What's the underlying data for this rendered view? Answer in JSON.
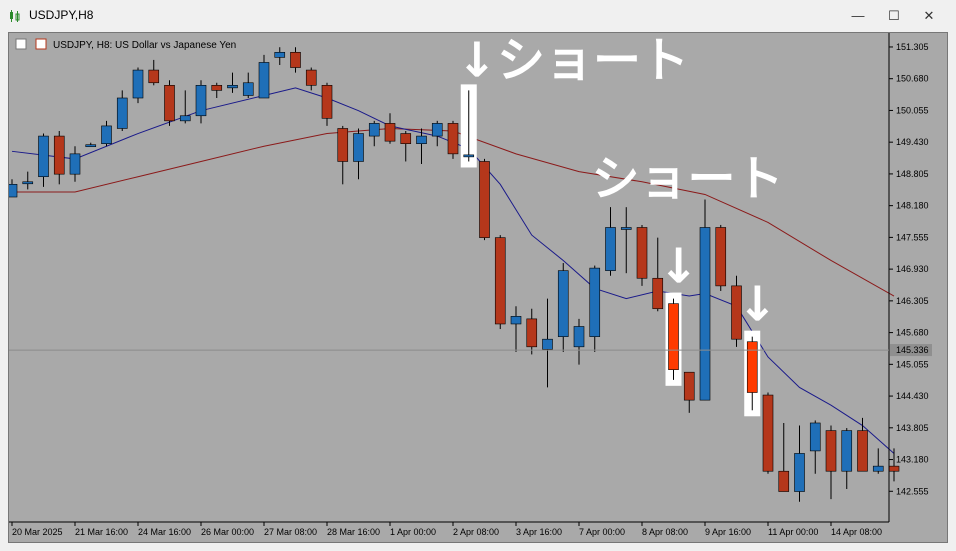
{
  "window": {
    "title": "USDJPY,H8",
    "minimize": "—",
    "maximize": "☐",
    "close": "✕"
  },
  "chart_data": {
    "type": "candlestick",
    "symbol_label": "USDJPY, H8:  US Dollar vs Japanese Yen",
    "y_ticks": [
      "151.305",
      "150.680",
      "150.055",
      "149.430",
      "148.805",
      "148.180",
      "147.555",
      "146.930",
      "146.305",
      "145.680",
      "145.055",
      "144.430",
      "143.805",
      "143.180",
      "142.555"
    ],
    "ylim": [
      141.95,
      151.58
    ],
    "current_price": "145.336",
    "x_ticks": [
      "20 Mar 2025",
      "21 Mar 16:00",
      "24 Mar 16:00",
      "26 Mar 00:00",
      "27 Mar 08:00",
      "28 Mar 16:00",
      "1 Apr 00:00",
      "2 Apr 08:00",
      "3 Apr 16:00",
      "7 Apr 00:00",
      "8 Apr 08:00",
      "9 Apr 16:00",
      "11 Apr 00:00",
      "14 Apr 08:00"
    ],
    "colors": {
      "bull": "#1f6fb8",
      "bear": "#b5371b",
      "highlight_bear": "#ff3b00",
      "ma_fast": "#1a1a8a",
      "ma_slow": "#8b1a1a",
      "background": "#a9a9a9"
    },
    "candles": [
      {
        "o": 148.35,
        "h": 148.7,
        "l": 148.35,
        "c": 148.6
      },
      {
        "o": 148.65,
        "h": 148.85,
        "l": 148.5,
        "c": 148.65
      },
      {
        "o": 148.75,
        "h": 149.6,
        "l": 148.55,
        "c": 149.55
      },
      {
        "o": 149.55,
        "h": 149.65,
        "l": 148.6,
        "c": 148.8
      },
      {
        "o": 148.8,
        "h": 149.35,
        "l": 148.65,
        "c": 149.2
      },
      {
        "o": 149.38,
        "h": 149.42,
        "l": 149.34,
        "c": 149.38
      },
      {
        "o": 149.4,
        "h": 149.85,
        "l": 149.35,
        "c": 149.75
      },
      {
        "o": 149.7,
        "h": 150.45,
        "l": 149.65,
        "c": 150.3
      },
      {
        "o": 150.3,
        "h": 150.9,
        "l": 150.2,
        "c": 150.85
      },
      {
        "o": 150.85,
        "h": 151.05,
        "l": 150.55,
        "c": 150.6
      },
      {
        "o": 150.55,
        "h": 150.65,
        "l": 149.75,
        "c": 149.85
      },
      {
        "o": 149.85,
        "h": 150.45,
        "l": 149.8,
        "c": 149.95
      },
      {
        "o": 149.95,
        "h": 150.65,
        "l": 149.8,
        "c": 150.55
      },
      {
        "o": 150.55,
        "h": 150.6,
        "l": 150.3,
        "c": 150.45
      },
      {
        "o": 150.5,
        "h": 150.8,
        "l": 150.4,
        "c": 150.55
      },
      {
        "o": 150.35,
        "h": 150.8,
        "l": 150.3,
        "c": 150.6
      },
      {
        "o": 150.3,
        "h": 151.15,
        "l": 150.3,
        "c": 151.0
      },
      {
        "o": 151.1,
        "h": 151.3,
        "l": 150.95,
        "c": 151.2
      },
      {
        "o": 151.2,
        "h": 151.3,
        "l": 150.8,
        "c": 150.9
      },
      {
        "o": 150.85,
        "h": 150.9,
        "l": 150.45,
        "c": 150.55
      },
      {
        "o": 150.55,
        "h": 150.6,
        "l": 149.75,
        "c": 149.9
      },
      {
        "o": 149.7,
        "h": 149.75,
        "l": 148.6,
        "c": 149.05
      },
      {
        "o": 149.05,
        "h": 149.7,
        "l": 148.7,
        "c": 149.6
      },
      {
        "o": 149.55,
        "h": 149.85,
        "l": 149.35,
        "c": 149.8
      },
      {
        "o": 149.8,
        "h": 150.0,
        "l": 149.4,
        "c": 149.45
      },
      {
        "o": 149.6,
        "h": 149.65,
        "l": 149.05,
        "c": 149.4
      },
      {
        "o": 149.4,
        "h": 149.7,
        "l": 149.0,
        "c": 149.55
      },
      {
        "o": 149.55,
        "h": 149.85,
        "l": 149.35,
        "c": 149.8
      },
      {
        "o": 149.8,
        "h": 149.85,
        "l": 149.1,
        "c": 149.2
      },
      {
        "o": 149.18,
        "h": 150.45,
        "l": 149.05,
        "c": 149.18
      },
      {
        "o": 149.05,
        "h": 149.1,
        "l": 147.5,
        "c": 147.55
      },
      {
        "o": 147.55,
        "h": 147.6,
        "l": 145.75,
        "c": 145.85
      },
      {
        "o": 145.85,
        "h": 146.2,
        "l": 145.3,
        "c": 146.0
      },
      {
        "o": 145.95,
        "h": 146.15,
        "l": 145.25,
        "c": 145.4
      },
      {
        "o": 145.35,
        "h": 146.35,
        "l": 144.6,
        "c": 145.55
      },
      {
        "o": 145.6,
        "h": 147.05,
        "l": 145.3,
        "c": 146.9
      },
      {
        "o": 145.4,
        "h": 145.95,
        "l": 145.05,
        "c": 145.8
      },
      {
        "o": 145.6,
        "h": 147.0,
        "l": 145.3,
        "c": 146.95
      },
      {
        "o": 146.9,
        "h": 148.15,
        "l": 146.8,
        "c": 147.75
      },
      {
        "o": 147.75,
        "h": 148.15,
        "l": 146.85,
        "c": 147.75
      },
      {
        "o": 147.75,
        "h": 147.8,
        "l": 146.6,
        "c": 146.75
      },
      {
        "o": 146.75,
        "h": 147.55,
        "l": 146.1,
        "c": 146.15
      },
      {
        "o": 146.25,
        "h": 146.35,
        "l": 144.75,
        "c": 144.95
      },
      {
        "o": 144.9,
        "h": 144.9,
        "l": 144.1,
        "c": 144.35
      },
      {
        "o": 144.35,
        "h": 148.3,
        "l": 144.35,
        "c": 147.75
      },
      {
        "o": 147.75,
        "h": 147.8,
        "l": 146.5,
        "c": 146.6
      },
      {
        "o": 146.6,
        "h": 146.8,
        "l": 145.4,
        "c": 145.55
      },
      {
        "o": 145.5,
        "h": 145.6,
        "l": 144.15,
        "c": 144.5
      },
      {
        "o": 144.45,
        "h": 144.5,
        "l": 142.9,
        "c": 142.95
      },
      {
        "o": 142.95,
        "h": 143.9,
        "l": 142.55,
        "c": 142.55
      },
      {
        "o": 142.55,
        "h": 143.85,
        "l": 142.35,
        "c": 143.3
      },
      {
        "o": 143.35,
        "h": 143.95,
        "l": 142.9,
        "c": 143.9
      },
      {
        "o": 143.75,
        "h": 143.85,
        "l": 142.4,
        "c": 142.95
      },
      {
        "o": 142.95,
        "h": 143.8,
        "l": 142.6,
        "c": 143.75
      },
      {
        "o": 143.75,
        "h": 144.0,
        "l": 142.95,
        "c": 142.95
      },
      {
        "o": 142.95,
        "h": 143.4,
        "l": 142.9,
        "c": 143.05
      },
      {
        "o": 143.05,
        "h": 143.4,
        "l": 142.75,
        "c": 142.95
      }
    ],
    "ma_fast": [
      {
        "i": 0,
        "v": 149.25
      },
      {
        "i": 4,
        "v": 149.1
      },
      {
        "i": 8,
        "v": 149.6
      },
      {
        "i": 12,
        "v": 150.05
      },
      {
        "i": 16,
        "v": 150.35
      },
      {
        "i": 18,
        "v": 150.5
      },
      {
        "i": 20,
        "v": 150.3
      },
      {
        "i": 22,
        "v": 150.05
      },
      {
        "i": 24,
        "v": 149.75
      },
      {
        "i": 27,
        "v": 149.55
      },
      {
        "i": 29,
        "v": 149.3
      },
      {
        "i": 31,
        "v": 148.6
      },
      {
        "i": 33,
        "v": 147.6
      },
      {
        "i": 35,
        "v": 147.1
      },
      {
        "i": 37,
        "v": 146.55
      },
      {
        "i": 39,
        "v": 146.35
      },
      {
        "i": 41,
        "v": 146.5
      },
      {
        "i": 43,
        "v": 146.4
      },
      {
        "i": 44,
        "v": 146.45
      },
      {
        "i": 46,
        "v": 146.2
      },
      {
        "i": 48,
        "v": 145.2
      },
      {
        "i": 50,
        "v": 144.6
      },
      {
        "i": 52,
        "v": 144.25
      },
      {
        "i": 54,
        "v": 143.85
      },
      {
        "i": 56,
        "v": 143.3
      }
    ],
    "ma_slow": [
      {
        "i": 0,
        "v": 148.45
      },
      {
        "i": 4,
        "v": 148.45
      },
      {
        "i": 8,
        "v": 148.75
      },
      {
        "i": 12,
        "v": 149.05
      },
      {
        "i": 16,
        "v": 149.35
      },
      {
        "i": 20,
        "v": 149.6
      },
      {
        "i": 24,
        "v": 149.7
      },
      {
        "i": 28,
        "v": 149.65
      },
      {
        "i": 32,
        "v": 149.2
      },
      {
        "i": 36,
        "v": 148.85
      },
      {
        "i": 40,
        "v": 148.65
      },
      {
        "i": 44,
        "v": 148.4
      },
      {
        "i": 48,
        "v": 147.85
      },
      {
        "i": 52,
        "v": 147.1
      },
      {
        "i": 56,
        "v": 146.4
      }
    ],
    "annotations": [
      {
        "text": "↓ショート",
        "candle": 29,
        "type": "primary"
      },
      {
        "text": "ショート",
        "candle": 42,
        "type": "secondary"
      },
      {
        "text": "↓",
        "candle": 42,
        "type": "arrow"
      },
      {
        "text": "↓",
        "candle": 47,
        "type": "arrow"
      }
    ],
    "highlighted_candles": [
      29,
      42,
      47
    ]
  }
}
